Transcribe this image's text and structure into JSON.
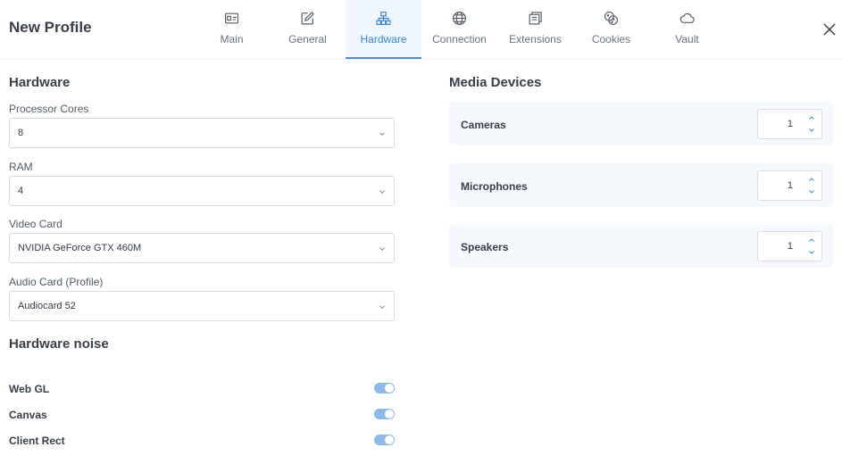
{
  "header": {
    "title": "New Profile",
    "tabs": [
      {
        "label": "Main",
        "icon": "id-card-icon"
      },
      {
        "label": "General",
        "icon": "edit-icon"
      },
      {
        "label": "Hardware",
        "icon": "network-icon"
      },
      {
        "label": "Connection",
        "icon": "globe-icon"
      },
      {
        "label": "Extensions",
        "icon": "extensions-icon"
      },
      {
        "label": "Cookies",
        "icon": "cookies-icon"
      },
      {
        "label": "Vault",
        "icon": "cloud-icon"
      }
    ],
    "active_tab": "Hardware"
  },
  "hardware": {
    "title": "Hardware",
    "fields": [
      {
        "label": "Processor Cores",
        "value": "8"
      },
      {
        "label": "RAM",
        "value": "4"
      },
      {
        "label": "Video Card",
        "value": "NVIDIA GeForce GTX 460M"
      },
      {
        "label": "Audio Card (Profile)",
        "value": "Audiocard 52"
      }
    ]
  },
  "noise": {
    "title": "Hardware noise",
    "items": [
      {
        "label": "Web GL",
        "on": true
      },
      {
        "label": "Canvas",
        "on": true
      },
      {
        "label": "Client Rect",
        "on": true
      }
    ]
  },
  "media": {
    "title": "Media Devices",
    "devices": [
      {
        "label": "Cameras",
        "value": "1"
      },
      {
        "label": "Microphones",
        "value": "1"
      },
      {
        "label": "Speakers",
        "value": "1"
      }
    ]
  },
  "colors": {
    "accent": "#3d85d6",
    "toggle_on": "#8fb8ea",
    "panel_bg": "#f5f8fc"
  }
}
